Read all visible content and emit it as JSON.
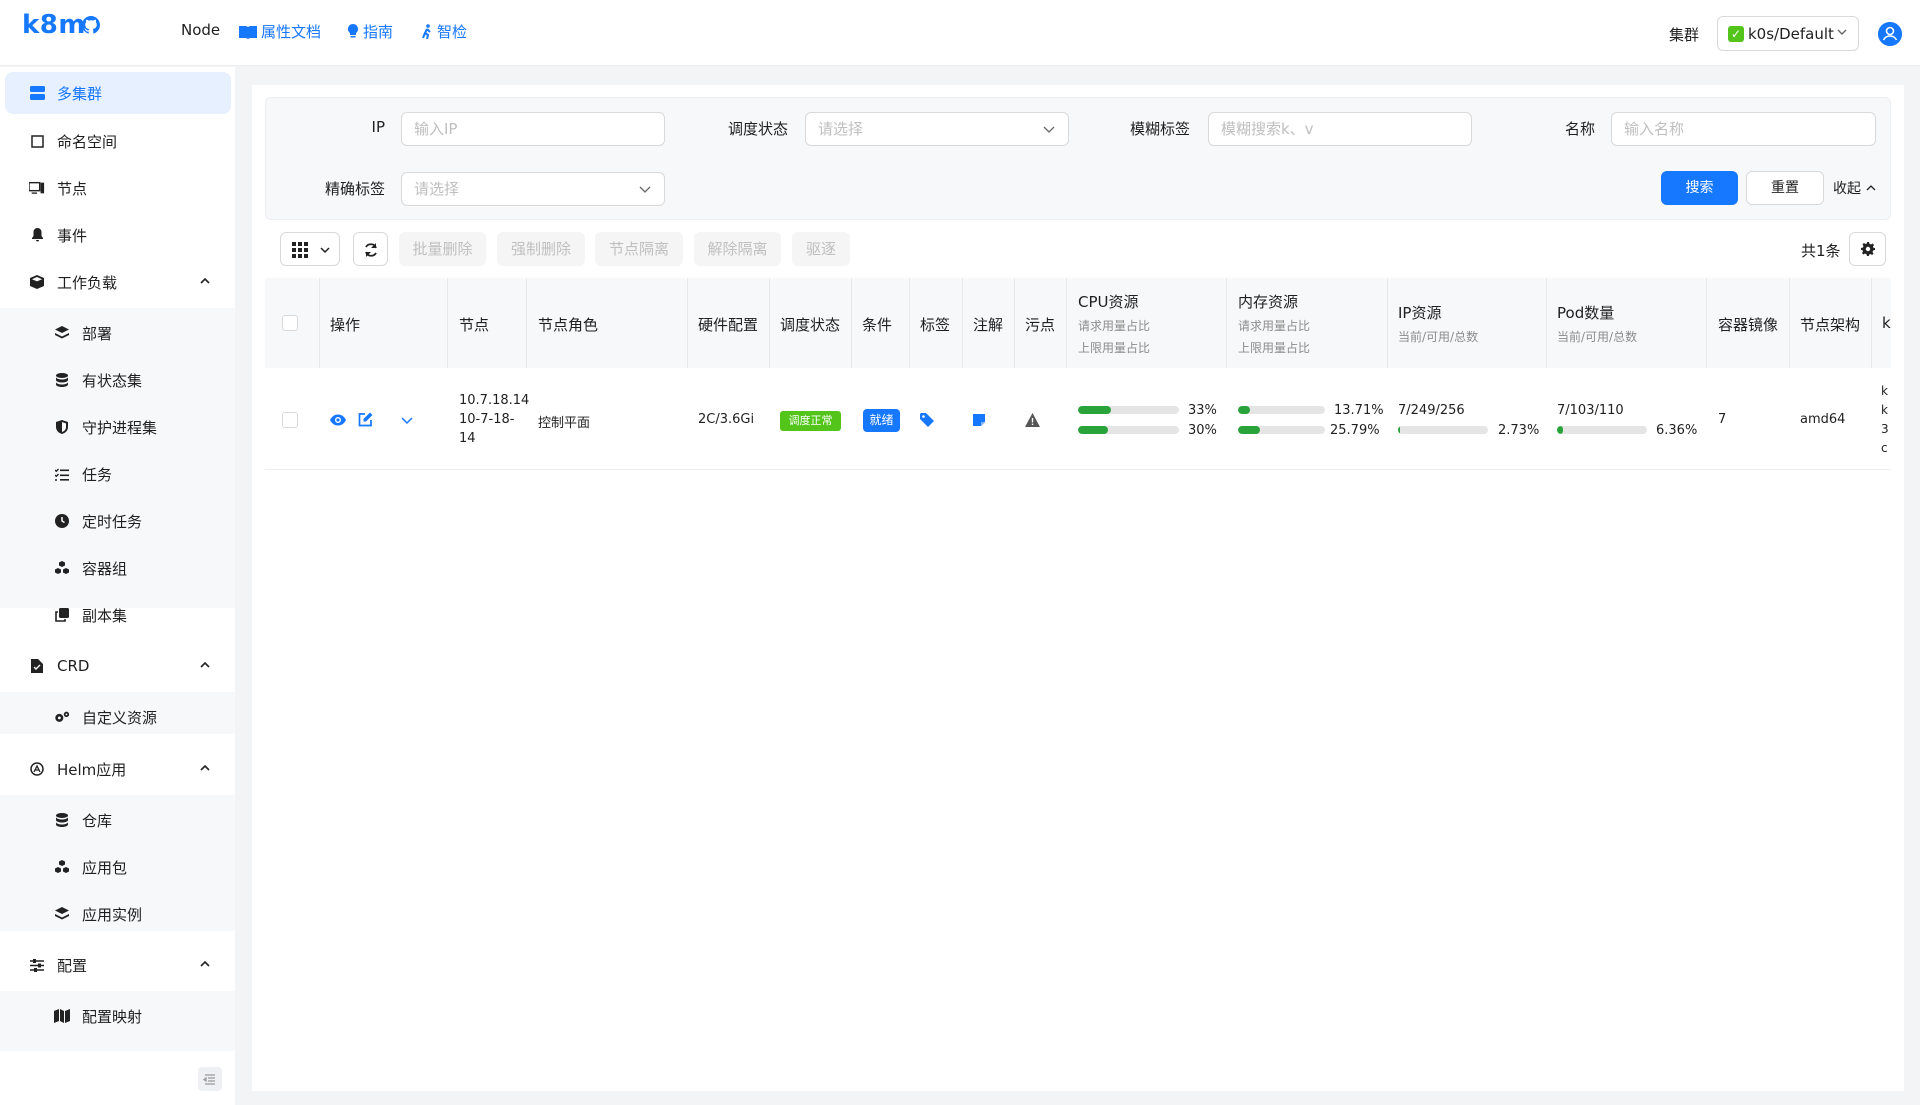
{
  "header": {
    "logo": "k8m",
    "nav_node": "Node",
    "nav_links": [
      "属性文档",
      "指南",
      "智检"
    ],
    "cluster_label": "集群",
    "cluster_value": "k0s/Default"
  },
  "sidebar": {
    "items": [
      {
        "label": "多集群",
        "icon": "server-icon",
        "active": true
      },
      {
        "label": "命名空间",
        "icon": "square-icon"
      },
      {
        "label": "节点",
        "icon": "desktop-icon"
      },
      {
        "label": "事件",
        "icon": "bell-icon"
      },
      {
        "label": "工作负载",
        "icon": "cube-icon",
        "expanded": true
      },
      {
        "label": "CRD",
        "icon": "file-icon",
        "expanded": true
      },
      {
        "label": "Helm应用",
        "icon": "helm-icon",
        "expanded": true
      },
      {
        "label": "配置",
        "icon": "sliders-icon",
        "expanded": true
      }
    ],
    "workload_sub": [
      {
        "label": "部署",
        "icon": "layers-icon"
      },
      {
        "label": "有状态集",
        "icon": "database-icon"
      },
      {
        "label": "守护进程集",
        "icon": "shield-icon"
      },
      {
        "label": "任务",
        "icon": "tasks-icon"
      },
      {
        "label": "定时任务",
        "icon": "clock-icon"
      },
      {
        "label": "容器组",
        "icon": "cubes-icon"
      },
      {
        "label": "副本集",
        "icon": "clone-icon"
      }
    ],
    "crd_sub": [
      {
        "label": "自定义资源",
        "icon": "gears-icon"
      }
    ],
    "helm_sub": [
      {
        "label": "仓库",
        "icon": "database-icon"
      },
      {
        "label": "应用包",
        "icon": "cubes-icon"
      },
      {
        "label": "应用实例",
        "icon": "layers-icon"
      }
    ],
    "config_sub": [
      {
        "label": "配置映射",
        "icon": "map-icon"
      }
    ]
  },
  "filter": {
    "ip_label": "IP",
    "ip_placeholder": "输入IP",
    "sched_label": "调度状态",
    "sched_placeholder": "请选择",
    "fuzzy_label": "模糊标签",
    "fuzzy_placeholder": "模糊搜索k、v",
    "name_label": "名称",
    "name_placeholder": "输入名称",
    "exact_label": "精确标签",
    "exact_placeholder": "请选择",
    "search_btn": "搜索",
    "reset_btn": "重置",
    "collapse": "收起"
  },
  "toolbar": {
    "batch_delete": "批量删除",
    "force_delete": "强制删除",
    "cordon": "节点隔离",
    "uncordon": "解除隔离",
    "drain": "驱逐",
    "total": "共1条"
  },
  "table": {
    "headers": {
      "ops": "操作",
      "node": "节点",
      "role": "节点角色",
      "hw": "硬件配置",
      "sched": "调度状态",
      "cond": "条件",
      "labels": "标签",
      "annot": "注解",
      "taints": "污点",
      "cpu": "CPU资源",
      "cpu_sub1": "请求用量占比",
      "cpu_sub2": "上限用量占比",
      "mem": "内存资源",
      "mem_sub1": "请求用量占比",
      "mem_sub2": "上限用量占比",
      "ip": "IP资源",
      "ip_sub": "当前/可用/总数",
      "pod": "Pod数量",
      "pod_sub": "当前/可用/总数",
      "images": "容器镜像",
      "arch": "节点架构",
      "clipped": "k"
    },
    "rows": [
      {
        "node_line1": "10.7.18.14",
        "node_line2": "10-7-18-",
        "node_line3": "14",
        "role": "控制平面",
        "hw": "2C/3.6Gi",
        "sched": "调度正常",
        "cond": "就绪",
        "cpu_req": "33%",
        "cpu_req_val": 0.33,
        "cpu_lim": "30%",
        "cpu_lim_val": 0.3,
        "mem_req": "13.71%",
        "mem_req_val": 0.1371,
        "mem_lim": "25.79%",
        "mem_lim_val": 0.2579,
        "ip_text": "7/249/256",
        "ip_pct": "2.73%",
        "ip_val": 0.0273,
        "pod_text": "7/103/110",
        "pod_pct": "6.36%",
        "pod_val": 0.0636,
        "images": "7",
        "arch": "amd64",
        "clipped": [
          "k",
          "k",
          "3",
          "c"
        ]
      }
    ]
  },
  "colors": {
    "accent": "#1677ff",
    "success": "#52c41a",
    "bar": "#2aa43a"
  }
}
